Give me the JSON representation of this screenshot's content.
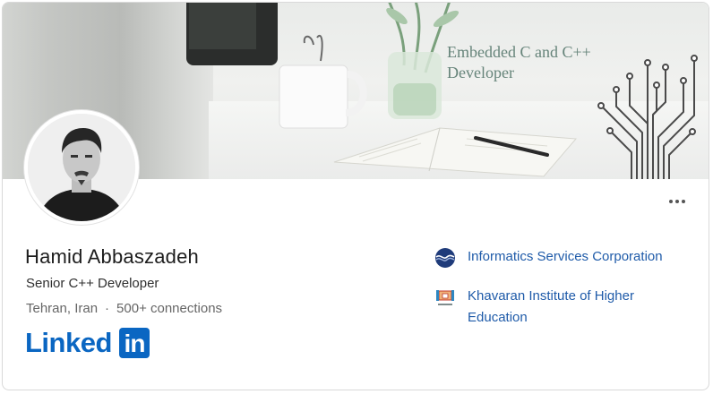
{
  "banner": {
    "text": "Embedded C and C++ Developer"
  },
  "profile": {
    "name": "Hamid Abbaszadeh",
    "headline": "Senior C++ Developer",
    "location": "Tehran, Iran",
    "separator": "·",
    "connections": "500+ connections"
  },
  "more_menu": {
    "icon": "more-horizontal-icon"
  },
  "organizations": [
    {
      "name": "Informatics Services Corporation",
      "icon": "informatics-services-logo-icon"
    },
    {
      "name": "Khavaran Institute of Higher Education",
      "icon": "khavaran-institute-logo-icon"
    }
  ],
  "brand": {
    "logo_text": "Linked",
    "logo_box_text": "in",
    "color": "#0a66c2"
  },
  "colors": {
    "link": "#1f5ba9",
    "name": "#1d1d1d",
    "muted": "#666666"
  }
}
